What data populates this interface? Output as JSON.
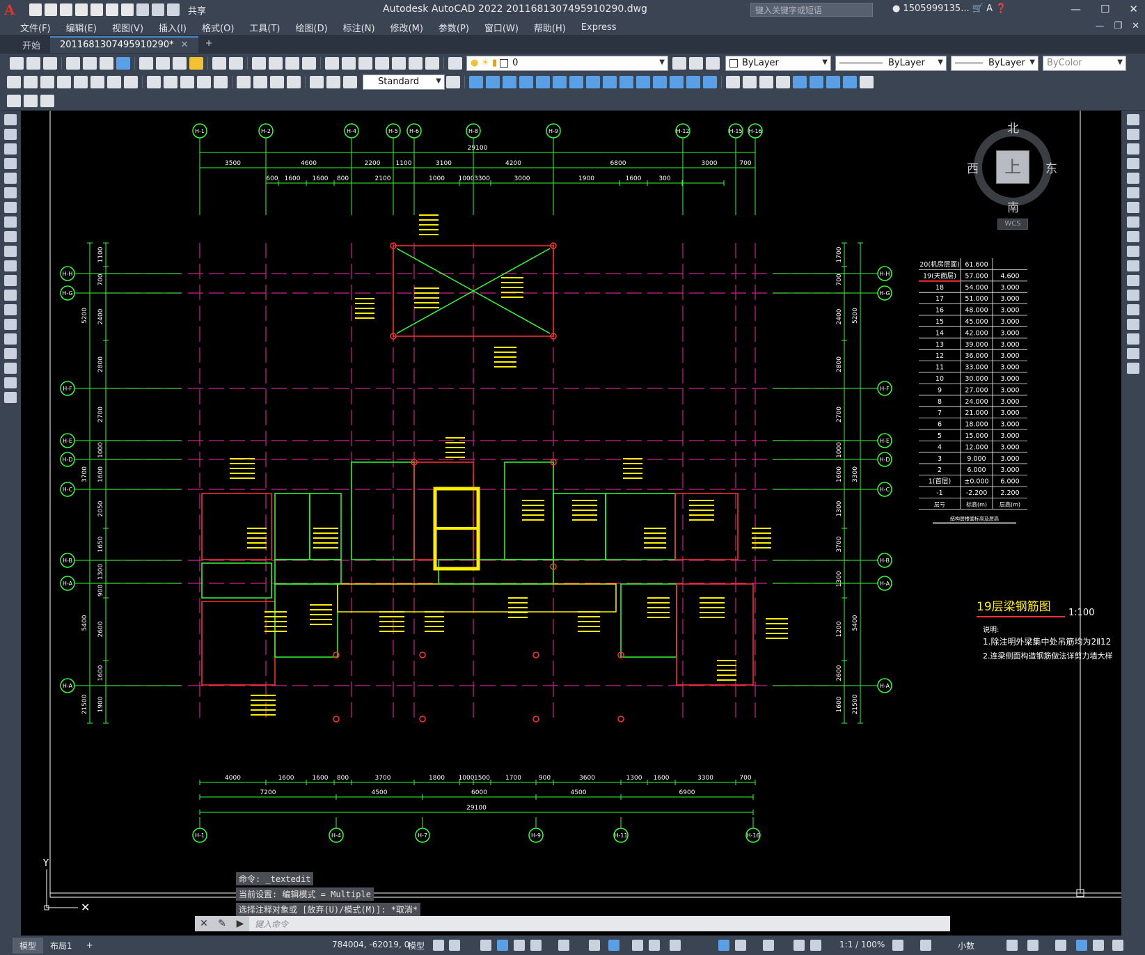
{
  "titlebar": {
    "share_label": "共享",
    "title": "Autodesk AutoCAD 2022    2011681307495910290.dwg",
    "search_placeholder": "键入关键字或短语",
    "user": "1505999135..."
  },
  "menu": [
    "文件(F)",
    "编辑(E)",
    "视图(V)",
    "插入(I)",
    "格式(O)",
    "工具(T)",
    "绘图(D)",
    "标注(N)",
    "修改(M)",
    "参数(P)",
    "窗口(W)",
    "帮助(H)",
    "Express"
  ],
  "tabs": {
    "start": "开始",
    "drawing": "2011681307495910290*"
  },
  "toolbar": {
    "layer_value": "0",
    "color_value": "ByLayer",
    "linetype_value": "ByLayer",
    "lineweight_value": "ByLayer",
    "plotstyle_value": "ByColor",
    "dimstyle_value": "Standard"
  },
  "viewcube": {
    "north": "北",
    "south": "南",
    "east": "东",
    "west": "西",
    "top": "上",
    "wcs": "WCS"
  },
  "drawing": {
    "axes_top": [
      "H-1",
      "H-2",
      "H-4",
      "H-5",
      "H-6",
      "H-8",
      "H-9",
      "H-12",
      "H-15",
      "H-16"
    ],
    "axes_bottom": [
      "H-1",
      "H-4",
      "H-7",
      "H-9",
      "H-11",
      "H-16"
    ],
    "axes_left": [
      "H-H",
      "H-G",
      "H-F",
      "H-E",
      "H-D",
      "H-C",
      "H-B",
      "H-A",
      "H-A"
    ],
    "dim_top_total": "29100",
    "dim_top_row1": [
      "3500",
      "4600",
      "2200",
      "1100",
      "3100",
      "4200",
      "6800",
      "3000",
      "700"
    ],
    "dim_top_row2": [
      "600",
      "1600",
      "1600",
      "800",
      "2100",
      "1000",
      "1000",
      "3300",
      "3000",
      "1900",
      "1600",
      "300"
    ],
    "dim_bottom_row1": [
      "4000",
      "1600",
      "1600",
      "800",
      "3700",
      "1800",
      "1000",
      "1500",
      "1700",
      "900",
      "3600",
      "1300",
      "1600",
      "3300",
      "700"
    ],
    "dim_bottom_row2": [
      "7200",
      "4500",
      "6000",
      "4500",
      "6900"
    ],
    "dim_bottom_total": "29100",
    "dim_left": [
      "1100",
      "700",
      "2400",
      "2800",
      "2700",
      "1000",
      "1600",
      "2050",
      "1650",
      "1300",
      "900",
      "2600",
      "1600",
      "1900"
    ],
    "dim_left_group": [
      "5200",
      "3700",
      "5400",
      "21500"
    ],
    "dim_right": [
      "1700",
      "700",
      "2400",
      "2800",
      "2700",
      "1000",
      "1600",
      "1300",
      "3700",
      "1300",
      "1200",
      "2600",
      "1600"
    ],
    "dim_right_group": [
      "5200",
      "3300",
      "5400",
      "21500"
    ],
    "drawing_title": "19层梁钢筋图",
    "scale": "1:100",
    "notes_heading": "说明:",
    "notes": [
      "1.除注明外梁集中处吊筋均为2Ⅱ12",
      "2.连梁侧面构造钢筋做法详剪力墙大样"
    ],
    "floor_table": {
      "rows": [
        [
          "20(机房层面)",
          "61.600",
          ""
        ],
        [
          "19(天面层)",
          "57.000",
          "4.600"
        ],
        [
          "18",
          "54.000",
          "3.000"
        ],
        [
          "17",
          "51.000",
          "3.000"
        ],
        [
          "16",
          "48.000",
          "3.000"
        ],
        [
          "15",
          "45.000",
          "3.000"
        ],
        [
          "14",
          "42.000",
          "3.000"
        ],
        [
          "13",
          "39.000",
          "3.000"
        ],
        [
          "12",
          "36.000",
          "3.000"
        ],
        [
          "11",
          "33.000",
          "3.000"
        ],
        [
          "10",
          "30.000",
          "3.000"
        ],
        [
          "9",
          "27.000",
          "3.000"
        ],
        [
          "8",
          "24.000",
          "3.000"
        ],
        [
          "7",
          "21.000",
          "3.000"
        ],
        [
          "6",
          "18.000",
          "3.000"
        ],
        [
          "5",
          "15.000",
          "3.000"
        ],
        [
          "4",
          "12.000",
          "3.000"
        ],
        [
          "3",
          "9.000",
          "3.000"
        ],
        [
          "2",
          "6.000",
          "3.000"
        ],
        [
          "1(首层)",
          "±0.000",
          "6.000"
        ],
        [
          "-1",
          "-2.200",
          "2.200"
        ]
      ],
      "footer": [
        "层号",
        "标高(m)",
        "层高(m)"
      ],
      "caption": "结构层楼面标高及层高"
    }
  },
  "command": {
    "history": [
      "命令: _textedit",
      "当前设置: 编辑模式 = Multiple",
      "选择注释对象或 [放弃(U)/模式(M)]: *取消*"
    ],
    "placeholder": "键入命令"
  },
  "status": {
    "tab_model": "模型",
    "tab_layout": "布局1",
    "coords": "784004, -62019, 0",
    "space": "模型",
    "scale": "1:1 / 100%",
    "units": "小数"
  }
}
